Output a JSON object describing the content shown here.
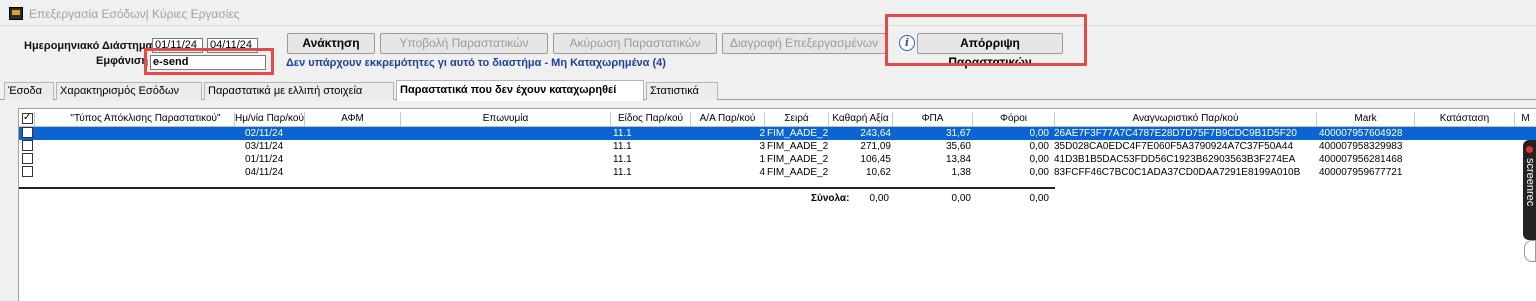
{
  "window": {
    "title": "Επεξεργασία Εσόδων| Κύριες Εργασίες"
  },
  "filters": {
    "date_range_label": "Ημερομηνιακό Διάστημα",
    "date_from": "01/11/24",
    "date_to": "04/11/24",
    "display_label": "Εμφάνιση",
    "display_value": "e-send"
  },
  "toolbar": {
    "retrieve": "Ανάκτηση",
    "submit": "Υποβολή Παραστατικών",
    "cancel": "Ακύρωση Παραστατικών",
    "delete": "Διαγραφή Επεξεργασμένων",
    "reject": "Απόρριψη Παραστατικών"
  },
  "status_message": "Δεν υπάρχουν εκκρεμότητες γι αυτό το διαστήμα - Μη Καταχωρημένα (4)",
  "tabs": [
    {
      "label": "Έσοδα"
    },
    {
      "label": "Χαρακτηρισμός Εσόδων"
    },
    {
      "label": "Παραστατικά με ελλιπή στοιχεία"
    },
    {
      "label": "Παραστατικά που δεν έχουν καταχωρηθεί",
      "active": true
    },
    {
      "label": "Στατιστικά"
    }
  ],
  "table": {
    "columns": [
      "\"Τύπος Απόκλισης Παραστατικού\"",
      "Ημ/νία Παρ/κού",
      "ΑΦΜ",
      "Επωνυμία",
      "Είδος Παρ/κού",
      "Α/Α Παρ/κού",
      "Σειρά",
      "Καθαρή Αξία",
      "ΦΠΑ",
      "Φόροι",
      "Αναγνωριστικό Παρ/κού",
      "Mark",
      "Κατάσταση",
      "M"
    ],
    "rows": [
      {
        "date": "02/11/24",
        "type": "11.1",
        "aa": "2",
        "series": "FIM_AADE_2",
        "net": "243,64",
        "vat": "31,67",
        "taxes": "0,00",
        "uid": "26AE7F3F77A7C4787E28D7D75F7B9CDC9B1D5F20",
        "mark": "400007957604928",
        "selected": true
      },
      {
        "date": "03/11/24",
        "type": "11.1",
        "aa": "3",
        "series": "FIM_AADE_2",
        "net": "271,09",
        "vat": "35,60",
        "taxes": "0,00",
        "uid": "35D028CA0EDC4F7E060F5A3790924A7C37F50A44",
        "mark": "400007958329983"
      },
      {
        "date": "01/11/24",
        "type": "11.1",
        "aa": "1",
        "series": "FIM_AADE_2",
        "net": "106,45",
        "vat": "13,84",
        "taxes": "0,00",
        "uid": "41D3B1B5DAC53FDD56C1923B62903563B3F274EA",
        "mark": "400007956281468"
      },
      {
        "date": "04/11/24",
        "type": "11.1",
        "aa": "4",
        "series": "FIM_AADE_2",
        "net": "10,62",
        "vat": "1,38",
        "taxes": "0,00",
        "uid": "83FCFF46C7BC0C1ADA37CD0DAA7291E8199A010B",
        "mark": "400007959677721"
      }
    ],
    "totals": {
      "label": "Σύνολα:",
      "net": "0,00",
      "vat": "0,00",
      "taxes": "0,00"
    }
  },
  "overlay": {
    "recorder_text": "screenrec"
  },
  "colors": {
    "selection": "#0a64d2",
    "highlight_box": "#e24b48",
    "status_text": "#1c3fa0"
  }
}
